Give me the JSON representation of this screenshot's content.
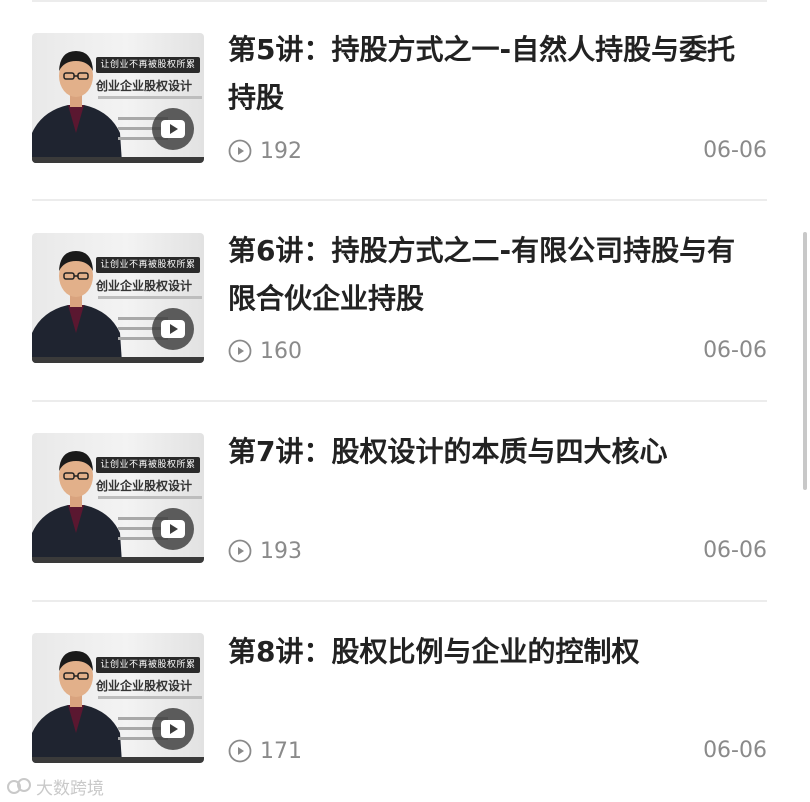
{
  "lessons": [
    {
      "title": "第5讲：持股方式之一-自然人持股与委托持股",
      "views": "192",
      "date": "06-06",
      "thumbnail": {
        "banner": "让创业不再被股权所累",
        "course_title": "创业企业股权设计"
      }
    },
    {
      "title": "第6讲：持股方式之二-有限公司持股与有限合伙企业持股",
      "views": "160",
      "date": "06-06",
      "thumbnail": {
        "banner": "让创业不再被股权所累",
        "course_title": "创业企业股权设计"
      }
    },
    {
      "title": "第7讲：股权设计的本质与四大核心",
      "views": "193",
      "date": "06-06",
      "thumbnail": {
        "banner": "让创业不再被股权所累",
        "course_title": "创业企业股权设计"
      }
    },
    {
      "title": "第8讲：股权比例与企业的控制权",
      "views": "171",
      "date": "06-06",
      "thumbnail": {
        "banner": "让创业不再被股权所累",
        "course_title": "创业企业股权设计"
      }
    }
  ],
  "watermark": {
    "text": "大数跨境"
  },
  "icons": {
    "views": "play-circle-icon",
    "thumbnail_overlay": "video-play-icon",
    "watermark": "brand-logo-icon"
  },
  "colors": {
    "title": "#222222",
    "meta": "#8a8a8a",
    "divider": "#ececec",
    "play_overlay": "#3c3c3c"
  }
}
